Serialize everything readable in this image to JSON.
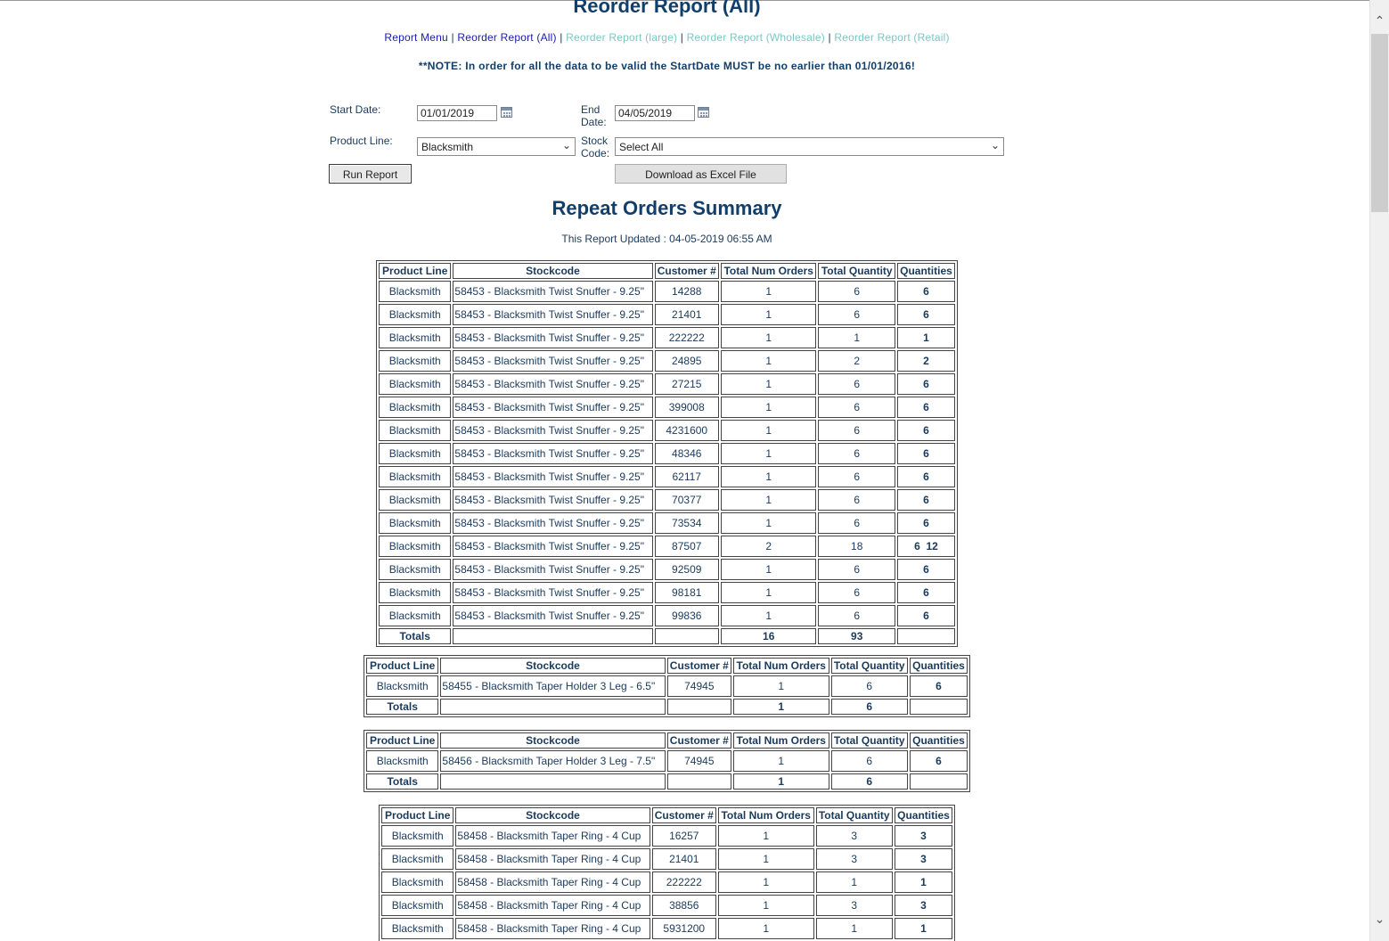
{
  "title": "Reorder Report (All)",
  "nav": {
    "report_menu": "Report Menu",
    "reorder_all": "Reorder Report (All)",
    "reorder_large": "Reorder Report (large)",
    "reorder_wholesale": "Reorder Report (Wholesale)",
    "reorder_retail": "Reorder Report (Retail)",
    "sep": "|"
  },
  "note": "**NOTE: In order for all the data to be valid the StartDate MUST be no earlier than 01/01/2016!",
  "form": {
    "start_date_label": "Start Date:",
    "start_date_value": "01/01/2019",
    "end_date_label_1": "End",
    "end_date_label_2": "Date:",
    "end_date_value": "04/05/2019",
    "product_line_label": "Product Line:",
    "product_line_value": "Blacksmith",
    "stock_code_label_1": "Stock",
    "stock_code_label_2": "Code:",
    "stock_code_value": "Select All",
    "run_button": "Run Report",
    "download_button": "Download as Excel File"
  },
  "summary_title": "Repeat Orders Summary",
  "updated_text": "This Report Updated : 04-05-2019 06:55 AM",
  "columns": [
    "Product Line",
    "Stockcode",
    "Customer #",
    "Total Num Orders",
    "Total Quantity",
    "Quantities"
  ],
  "totals_label": "Totals",
  "tables": [
    {
      "rows": [
        [
          "Blacksmith",
          "58453 - Blacksmith Twist Snuffer - 9.25\"",
          "14288",
          "1",
          "6",
          "6"
        ],
        [
          "Blacksmith",
          "58453 - Blacksmith Twist Snuffer - 9.25\"",
          "21401",
          "1",
          "6",
          "6"
        ],
        [
          "Blacksmith",
          "58453 - Blacksmith Twist Snuffer - 9.25\"",
          "222222",
          "1",
          "1",
          "1"
        ],
        [
          "Blacksmith",
          "58453 - Blacksmith Twist Snuffer - 9.25\"",
          "24895",
          "1",
          "2",
          "2"
        ],
        [
          "Blacksmith",
          "58453 - Blacksmith Twist Snuffer - 9.25\"",
          "27215",
          "1",
          "6",
          "6"
        ],
        [
          "Blacksmith",
          "58453 - Blacksmith Twist Snuffer - 9.25\"",
          "399008",
          "1",
          "6",
          "6"
        ],
        [
          "Blacksmith",
          "58453 - Blacksmith Twist Snuffer - 9.25\"",
          "4231600",
          "1",
          "6",
          "6"
        ],
        [
          "Blacksmith",
          "58453 - Blacksmith Twist Snuffer - 9.25\"",
          "48346",
          "1",
          "6",
          "6"
        ],
        [
          "Blacksmith",
          "58453 - Blacksmith Twist Snuffer - 9.25\"",
          "62117",
          "1",
          "6",
          "6"
        ],
        [
          "Blacksmith",
          "58453 - Blacksmith Twist Snuffer - 9.25\"",
          "70377",
          "1",
          "6",
          "6"
        ],
        [
          "Blacksmith",
          "58453 - Blacksmith Twist Snuffer - 9.25\"",
          "73534",
          "1",
          "6",
          "6"
        ],
        [
          "Blacksmith",
          "58453 - Blacksmith Twist Snuffer - 9.25\"",
          "87507",
          "2",
          "18",
          "6  12"
        ],
        [
          "Blacksmith",
          "58453 - Blacksmith Twist Snuffer - 9.25\"",
          "92509",
          "1",
          "6",
          "6"
        ],
        [
          "Blacksmith",
          "58453 - Blacksmith Twist Snuffer - 9.25\"",
          "98181",
          "1",
          "6",
          "6"
        ],
        [
          "Blacksmith",
          "58453 - Blacksmith Twist Snuffer - 9.25\"",
          "99836",
          "1",
          "6",
          "6"
        ]
      ],
      "total_orders": "16",
      "total_quantity": "93"
    },
    {
      "rows": [
        [
          "Blacksmith",
          "58455 - Blacksmith Taper Holder 3 Leg - 6.5\"",
          "74945",
          "1",
          "6",
          "6"
        ]
      ],
      "total_orders": "1",
      "total_quantity": "6"
    },
    {
      "rows": [
        [
          "Blacksmith",
          "58456 - Blacksmith Taper Holder 3 Leg - 7.5\"",
          "74945",
          "1",
          "6",
          "6"
        ]
      ],
      "total_orders": "1",
      "total_quantity": "6"
    },
    {
      "rows": [
        [
          "Blacksmith",
          "58458 - Blacksmith Taper Ring - 4 Cup",
          "16257",
          "1",
          "3",
          "3"
        ],
        [
          "Blacksmith",
          "58458 - Blacksmith Taper Ring - 4 Cup",
          "21401",
          "1",
          "3",
          "3"
        ],
        [
          "Blacksmith",
          "58458 - Blacksmith Taper Ring - 4 Cup",
          "222222",
          "1",
          "1",
          "1"
        ],
        [
          "Blacksmith",
          "58458 - Blacksmith Taper Ring - 4 Cup",
          "38856",
          "1",
          "3",
          "3"
        ],
        [
          "Blacksmith",
          "58458 - Blacksmith Taper Ring - 4 Cup",
          "5931200",
          "1",
          "1",
          "1"
        ]
      ],
      "total_orders": "",
      "total_quantity": ""
    }
  ]
}
